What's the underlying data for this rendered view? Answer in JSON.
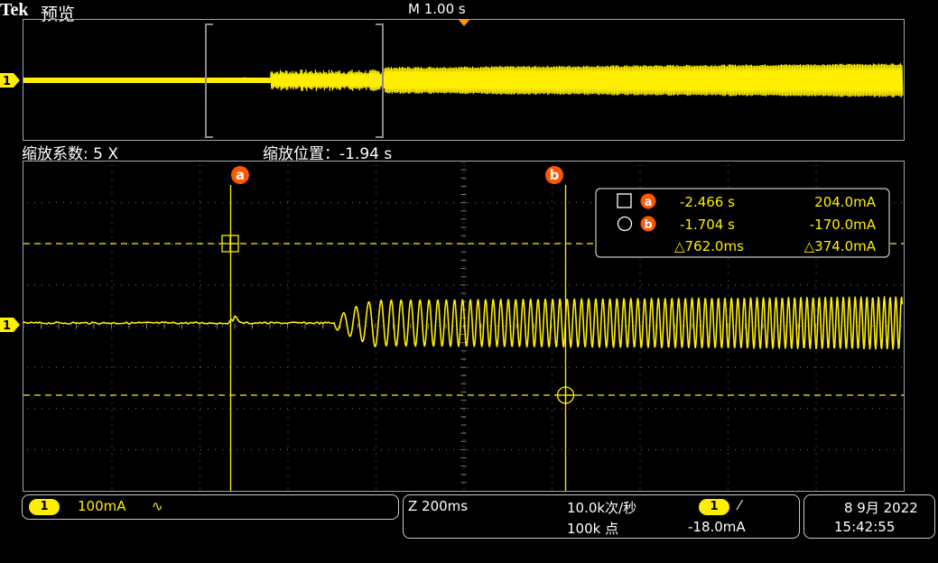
{
  "header": {
    "brand": "Tek",
    "brand_suffix": "预览",
    "horizontal_scale": "M 1.00 s"
  },
  "zoom": {
    "factor_label": "缩放系数: 5 X",
    "position_label": "缩放位置：-1.94 s"
  },
  "channel_marker": "1",
  "cursors": {
    "a_label": "a",
    "b_label": "b",
    "a_time": "-2.466 s",
    "a_value": "204.0mA",
    "b_time": "-1.704 s",
    "b_value": "-170.0mA",
    "delta_time": "△762.0ms",
    "delta_value": "△374.0mA"
  },
  "status": {
    "channel_num": "1",
    "channel_scale": "100mA",
    "bandwidth_symbol": "∿",
    "zoom_timebase": "Z 200ms",
    "sample_rate": "10.0k次/秒",
    "record_length": "100k 点",
    "trigger_channel": "1",
    "trigger_slope": "⁄",
    "trigger_level": "-18.0mA",
    "date": "8 9月 2022",
    "time": "15:42:55"
  },
  "colors": {
    "trace": "#ffee00",
    "cursor_badge": "#ff5500",
    "grid": "#7a7a7a",
    "frame": "#9aa8b4"
  }
}
